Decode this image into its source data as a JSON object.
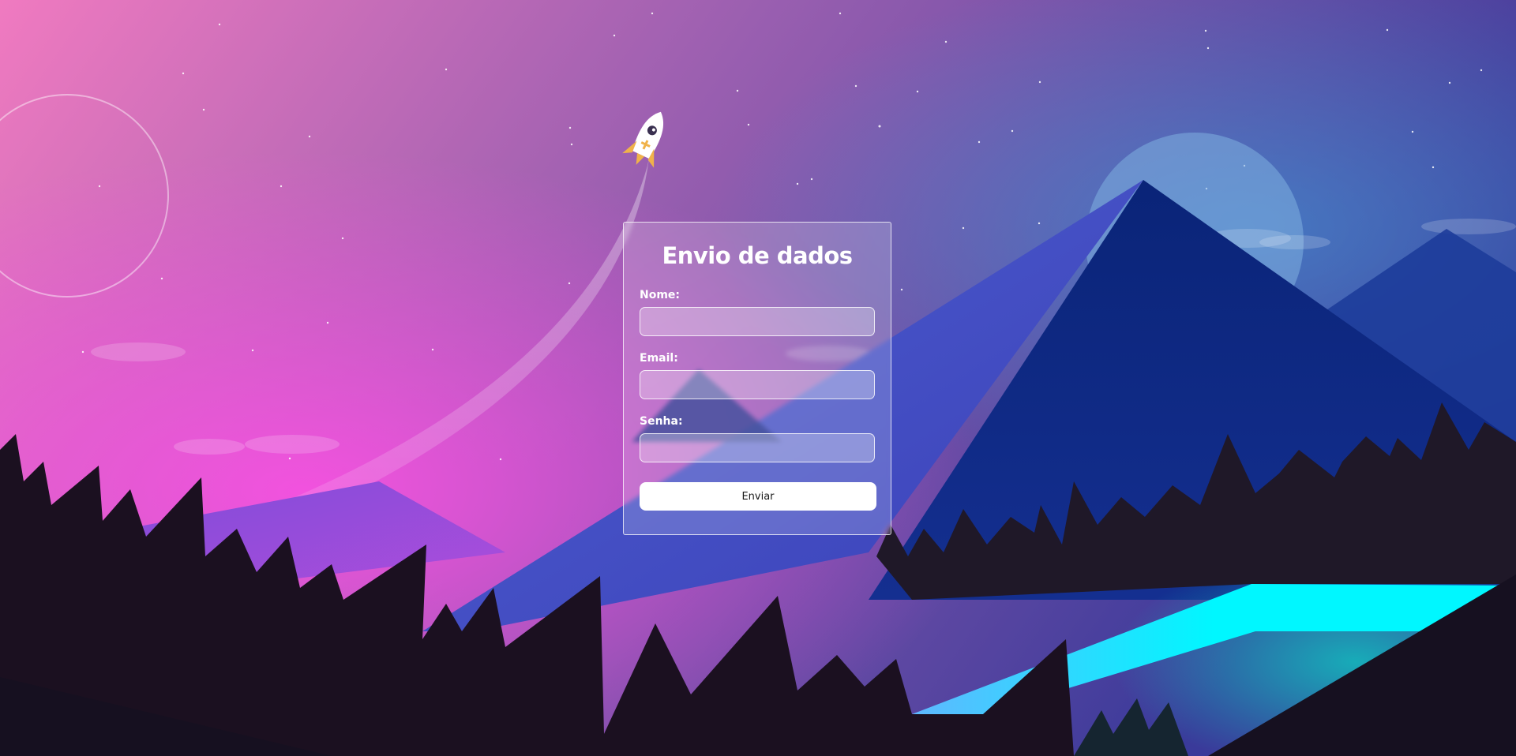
{
  "form": {
    "title": "Envio de dados",
    "fields": [
      {
        "label": "Nome:",
        "value": "",
        "placeholder": ""
      },
      {
        "label": "Email:",
        "value": "",
        "placeholder": ""
      },
      {
        "label": "Senha:",
        "value": "",
        "placeholder": ""
      }
    ],
    "submit_label": "Enviar"
  },
  "background": {
    "sky_colors": [
      "#f07ac0",
      "#9a5fb0",
      "#3a3a9a"
    ],
    "mountain_color": "#0a2478",
    "river_color": "#00f7ff",
    "forest_color": "#1b1020",
    "rocket_color": "#ffffff",
    "rocket_flame_color": "#f0b24a"
  }
}
